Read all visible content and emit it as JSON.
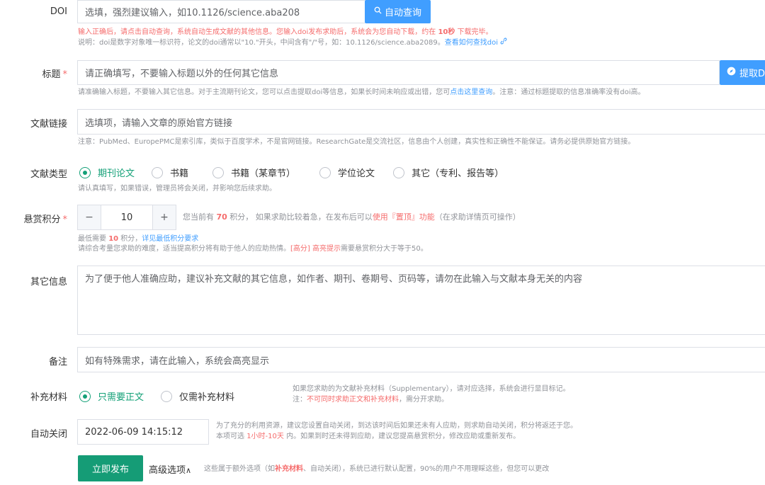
{
  "doi": {
    "label": "DOI",
    "placeholder": "选填，强烈建议输入，如10.1126/science.aba208",
    "lookup_button": "自动查询",
    "hint1_a": "输入正确后，请点击自动查询，系统自动生成文献的其他信息。您输入doi发布求助后，系统会为您自动下载，约在 ",
    "hint1_b": "10秒",
    "hint1_c": " 下载完毕。",
    "hint2": "说明：doi是数字对象唯一标识符，论文的doi通常以\"10.\"开头，中间含有\"/\"号，如：10.1126/science.aba2089。",
    "hint2_link": "查看如何查找doi"
  },
  "title": {
    "label": "标题",
    "required": "*",
    "placeholder": "请正确填写，不要输入标题以外的任何其它信息",
    "extract_button": "提取D",
    "hint_a": "请准确输入标题，不要输入其它信息。对于主流期刊论文，您可以点击提取doi等信息，如果长时间未响应或出错，您可",
    "hint_link": "点击这里查询",
    "hint_b": "。注意：通过标题提取的信息准确率没有doi高。"
  },
  "link": {
    "label": "文献链接",
    "placeholder": "选填项，请输入文章的原始官方链接",
    "hint": "注意：PubMed、EuropePMC是索引库，类似于百度学术，不是官网链接。ResearchGate是交流社区，信息由个人创建，真实性和正确性不能保证。请务必提供原始官方链接。"
  },
  "type": {
    "label": "文献类型",
    "options": [
      "期刊论文",
      "书籍",
      "书籍（某章节）",
      "学位论文",
      "其它（专利、报告等）"
    ],
    "hint": "请认真填写，如果错误，管理员将会关闭，并影响您后续求助。"
  },
  "reward": {
    "label": "悬赏积分",
    "required": "*",
    "minus": "−",
    "value": "10",
    "plus": "+",
    "info_a": "您当前有 ",
    "info_points": "70",
    "info_b": " 积分， 如果求助比较着急，在发布后可以",
    "info_link": "使用『置顶』功能",
    "info_c": "（在求助详情页可操作）",
    "min_a": "最低需要 ",
    "min_points": "10",
    "min_b": " 积分，",
    "min_link": "详见最低积分要求",
    "tip_a": "请综合考量您求助的难度，适当提高积分将有助于他人的应助热情。",
    "tip_tag": "[高分] 高亮提示",
    "tip_b": "需要悬赏积分大于等于50。"
  },
  "other": {
    "label": "其它信息",
    "placeholder": "为了便于他人准确应助，建议补充文献的其它信息，如作者、期刊、卷期号、页码等，请勿在此输入与文献本身无关的内容"
  },
  "remark": {
    "label": "备注",
    "placeholder": "如有特殊需求，请在此输入，系统会高亮显示"
  },
  "supplement": {
    "label": "补充材料",
    "options": [
      "只需要正文",
      "仅需补充材料"
    ],
    "hint1": "如果您求助的为文献补充材料（Supplementary），请对应选择，系统会进行显目标记。",
    "hint2_a": "注：",
    "hint2_red": "不可同时求助正文和补充材料",
    "hint2_b": "，需分开求助。"
  },
  "autoclose": {
    "label": "自动关闭",
    "value": "2022-06-09 14:15:12",
    "hint1": "为了充分的利用资源，建议您设置自动关闭，到达该时间后如果还未有人应助，则求助自动关闭，积分将返还于您。",
    "hint2_a": "本项可选 ",
    "hint2_red": "1小时-10天",
    "hint2_b": " 内。如果到时还未得到应助，建议您提高悬赏积分，修改应助或重新发布。"
  },
  "footer": {
    "publish": "立即发布",
    "advanced": "高级选项",
    "advanced_caret": "∧",
    "note_a": "这些属于额外选项（如",
    "note_red": "补充材料",
    "note_b": "、自动关闭），系统已进行默认配置，90%的用户不用理睬这些，但您可以更改"
  }
}
